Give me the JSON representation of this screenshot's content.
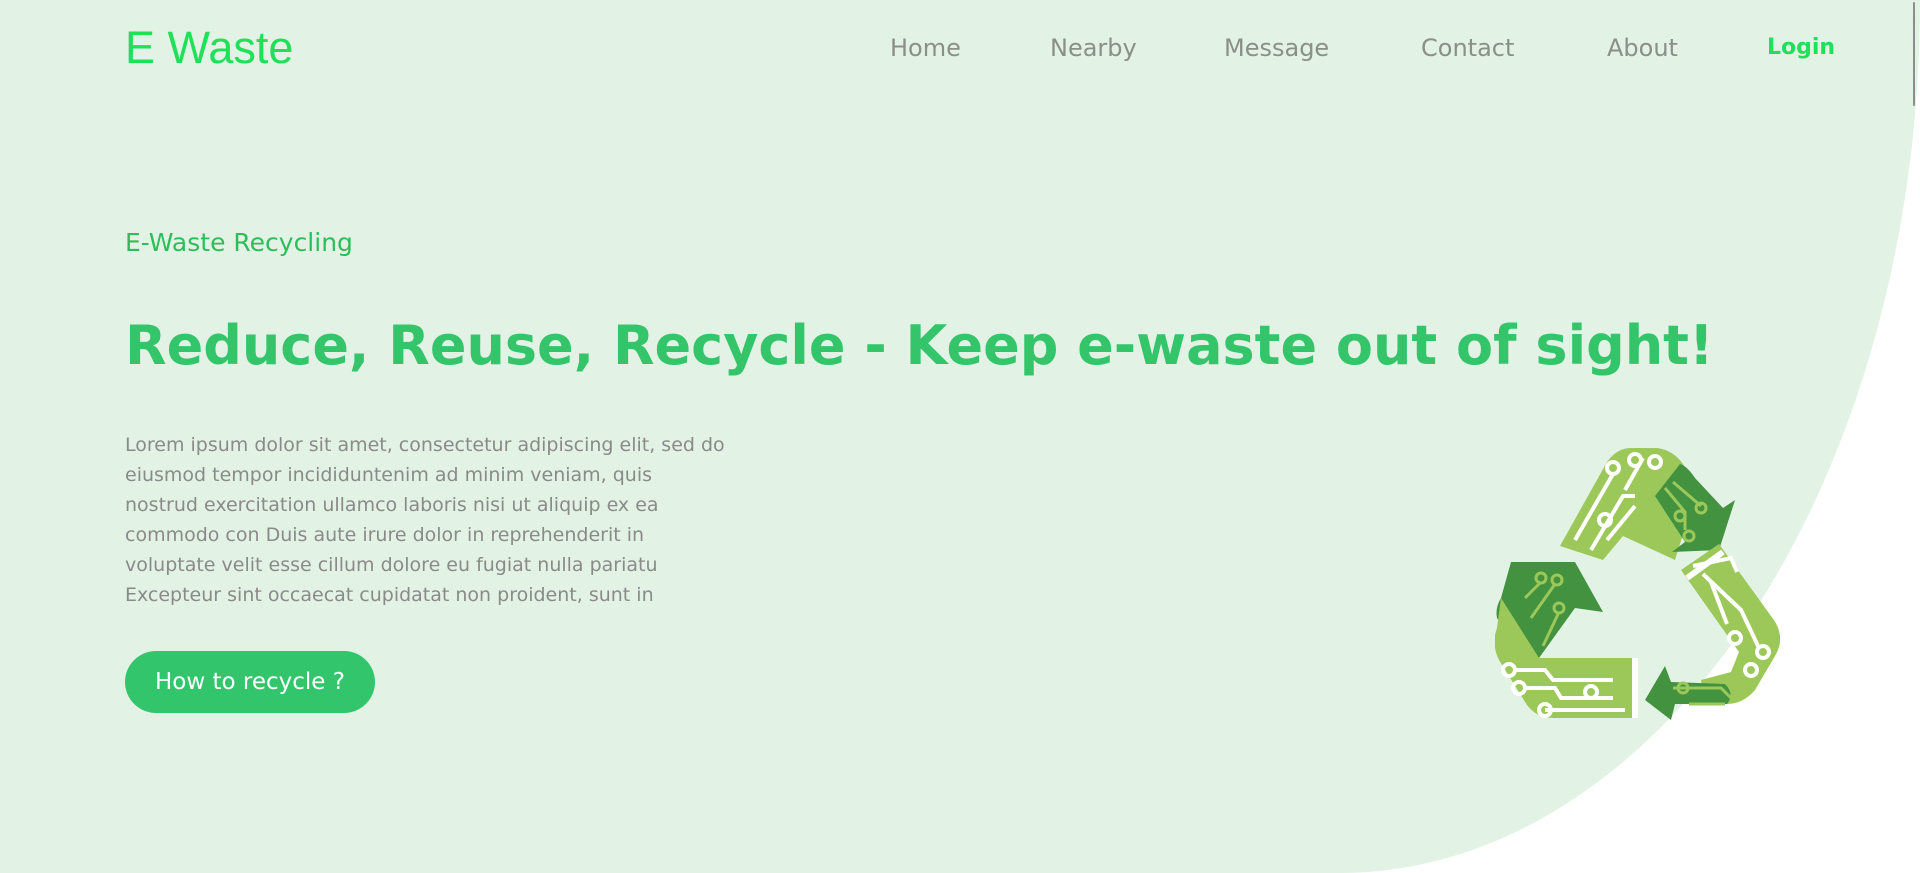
{
  "brand": {
    "name": "E Waste"
  },
  "nav": {
    "items": [
      {
        "label": "Home"
      },
      {
        "label": "Nearby"
      },
      {
        "label": "Message"
      },
      {
        "label": "Contact"
      },
      {
        "label": "About"
      }
    ],
    "login_label": "Login"
  },
  "hero": {
    "eyebrow": "E-Waste Recycling",
    "headline": "Reduce, Reuse, Recycle - Keep e-waste out of sight!",
    "description_lines": [
      "Lorem ipsum dolor sit amet, consectetur adipiscing elit, sed do",
      "eiusmod tempor incididuntenim ad minim veniam, quis",
      "nostrud exercitation ullamco laboris nisi ut aliquip ex ea",
      "commodo con Duis aute irure dolor in reprehenderit in",
      "voluptate velit esse cillum dolore eu fugiat nulla pariatu",
      "Excepteur sint occaecat cupidatat non proident, sunt in"
    ],
    "cta_label": "How to recycle ?",
    "illustration_icon": "circuit-recycle-icon"
  },
  "colors": {
    "background": "#e2f2e4",
    "brand_green": "#20e05a",
    "heading_green": "#34c56b",
    "nav_text": "#8a8f89",
    "body_text": "#8a8a8a",
    "button_bg": "#33c56b",
    "button_text": "#ffffff",
    "icon_light_green": "#9cc85a",
    "icon_dark_green": "#43923f"
  }
}
